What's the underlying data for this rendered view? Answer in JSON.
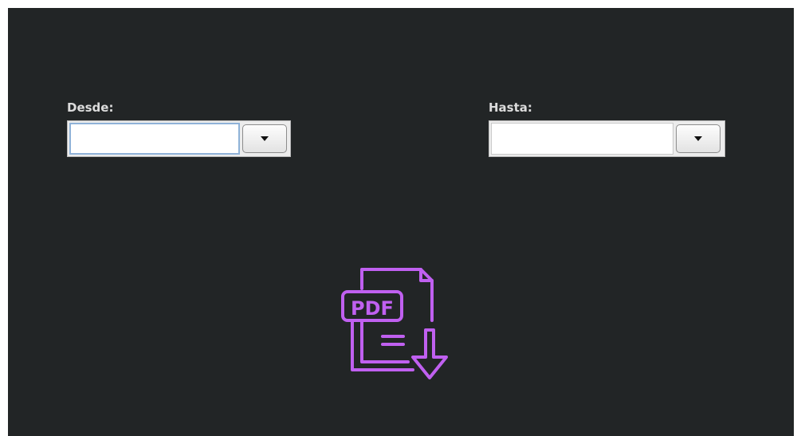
{
  "filters": {
    "from": {
      "label": "Desde:",
      "value": ""
    },
    "to": {
      "label": "Hasta:",
      "value": ""
    }
  },
  "export": {
    "icon": "pdf-download-icon",
    "icon_text": "PDF",
    "accent_color": "#c060f0"
  },
  "theme": {
    "background": "#222526",
    "label_color": "#dcdcdc"
  }
}
